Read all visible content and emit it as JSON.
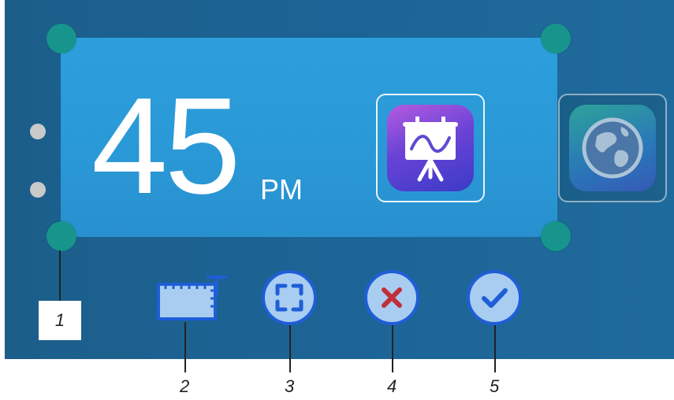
{
  "clock": {
    "value": "45",
    "suffix": "PM"
  },
  "apps": [
    {
      "name": "whiteboard",
      "icon": "whiteboard-app-icon",
      "selected": true
    },
    {
      "name": "browser",
      "icon": "globe-app-icon",
      "selected": false
    }
  ],
  "toolbar": {
    "buttons": [
      {
        "icon": "resize-ruler-icon"
      },
      {
        "icon": "fullscreen-icon"
      },
      {
        "icon": "close-icon"
      },
      {
        "icon": "checkmark-icon"
      }
    ]
  },
  "callouts": [
    "1",
    "2",
    "3",
    "4",
    "5"
  ],
  "colors": {
    "screen": "#1d6496",
    "widget": "#2a98d6",
    "handle": "#17958c",
    "button_fill": "#a9cdf1",
    "button_border": "#1f5ed6",
    "close_mark": "#c0303a",
    "check_mark": "#1f5ed6"
  }
}
